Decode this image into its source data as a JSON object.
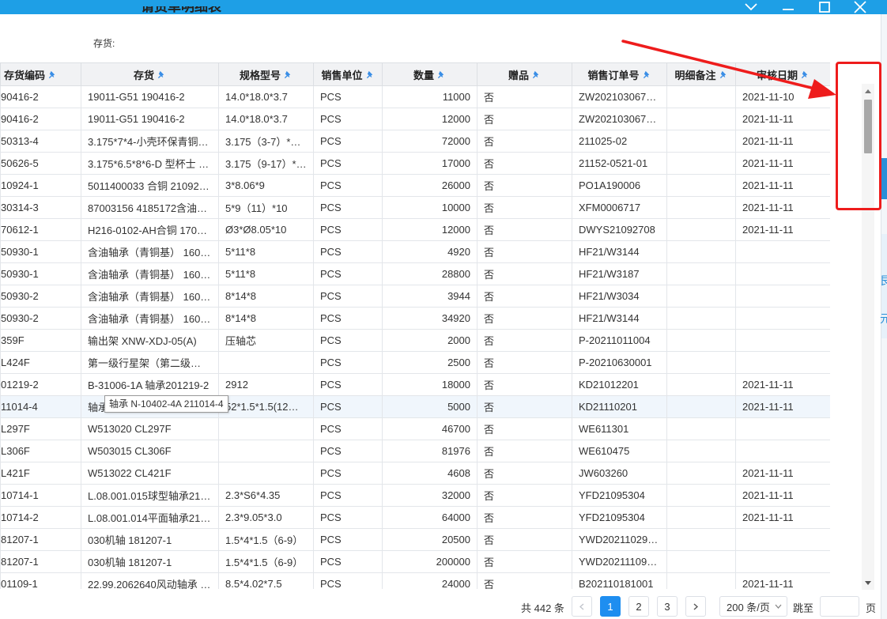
{
  "window": {
    "controls": [
      "chevron-down-icon",
      "minimize-icon",
      "maximize-icon",
      "close-icon"
    ],
    "accent": "#1e9fe6"
  },
  "header": {
    "title": "请货单明细表",
    "filter_label": "存货:"
  },
  "table": {
    "columns": [
      "存货编码",
      "存货",
      "规格型号",
      "销售单位",
      "数量",
      "赠品",
      "销售订单号",
      "明细备注",
      "审核日期"
    ],
    "rows": [
      [
        "90416-2",
        "19011-G51 190416-2",
        "14.0*18.0*3.7",
        "PCS",
        "11000",
        "否",
        "ZW202103067…",
        "",
        "2021-11-10"
      ],
      [
        "90416-2",
        "19011-G51 190416-2",
        "14.0*18.0*3.7",
        "PCS",
        "12000",
        "否",
        "ZW202103067…",
        "",
        "2021-11-11"
      ],
      [
        "50313-4",
        "3.175*7*4-小壳环保青铜…",
        "3.175（3-7）*…",
        "PCS",
        "72000",
        "否",
        "211025-02",
        "",
        "2021-11-11"
      ],
      [
        "50626-5",
        "3.175*6.5*8*6-D 型杯士 …",
        "3.175（9-17）*…",
        "PCS",
        "17000",
        "否",
        "21152-0521-01",
        "",
        "2021-11-11"
      ],
      [
        "10924-1",
        "5011400033 合铜 21092…",
        "3*8.06*9",
        "PCS",
        "26000",
        "否",
        "PO1A190006",
        "",
        "2021-11-11"
      ],
      [
        "30314-3",
        "87003156 4185172含油…",
        "5*9（11）*10",
        "PCS",
        "10000",
        "否",
        "XFM0006717",
        "",
        "2021-11-11"
      ],
      [
        "70612-1",
        "H216-0102-AH合铜 1706…",
        "Ø3*Ø8.05*10",
        "PCS",
        "12000",
        "否",
        "DWYS21092708",
        "",
        "2021-11-11"
      ],
      [
        "50930-1",
        "含油轴承（青铜基） 160…",
        "5*11*8",
        "PCS",
        "4920",
        "否",
        "HF21/W3144",
        "",
        ""
      ],
      [
        "50930-1",
        "含油轴承（青铜基） 160…",
        "5*11*8",
        "PCS",
        "28800",
        "否",
        "HF21/W3187",
        "",
        ""
      ],
      [
        "50930-2",
        "含油轴承（青铜基） 160…",
        "8*14*8",
        "PCS",
        "3944",
        "否",
        "HF21/W3034",
        "",
        ""
      ],
      [
        "50930-2",
        "含油轴承（青铜基） 160…",
        "8*14*8",
        "PCS",
        "34920",
        "否",
        "HF21/W3144",
        "",
        ""
      ],
      [
        "359F",
        "输出架 XNW-XDJ-05(A)",
        "压轴芯",
        "PCS",
        "2000",
        "否",
        "P-20211011004",
        "",
        ""
      ],
      [
        "L424F",
        "第一级行星架（第二级…",
        "",
        "PCS",
        "2500",
        "否",
        "P-20210630001",
        "",
        ""
      ],
      [
        "01219-2",
        "B-31006-1A 轴承201219-2",
        "2912",
        "PCS",
        "18000",
        "否",
        "KD21012201",
        "",
        "2021-11-11"
      ],
      [
        "11014-4",
        "轴承",
        "52*1.5*1.5(12…",
        "PCS",
        "5000",
        "否",
        "KD21110201",
        "",
        "2021-11-11"
      ],
      [
        "L297F",
        "W513020 CL297F",
        "",
        "PCS",
        "46700",
        "否",
        "WE611301",
        "",
        ""
      ],
      [
        "L306F",
        "W503015 CL306F",
        "",
        "PCS",
        "81976",
        "否",
        "WE610475",
        "",
        ""
      ],
      [
        "L421F",
        "W513022 CL421F",
        "",
        "PCS",
        "4608",
        "否",
        "JW603260",
        "",
        "2021-11-11"
      ],
      [
        "10714-1",
        "L.08.001.015球型轴承21…",
        "2.3*S6*4.35",
        "PCS",
        "32000",
        "否",
        "YFD21095304",
        "",
        "2021-11-11"
      ],
      [
        "10714-2",
        "L.08.001.014平面轴承21…",
        "2.3*9.05*3.0",
        "PCS",
        "64000",
        "否",
        "YFD21095304",
        "",
        "2021-11-11"
      ],
      [
        "81207-1",
        "030机轴 181207-1",
        "1.5*4*1.5（6-9）",
        "PCS",
        "20500",
        "否",
        "YWD20211029…",
        "",
        ""
      ],
      [
        "81207-1",
        "030机轴 181207-1",
        "1.5*4*1.5（6-9）",
        "PCS",
        "200000",
        "否",
        "YWD20211109…",
        "",
        ""
      ],
      [
        "01109-1",
        "22.99.2062640风动轴承 …",
        "8.5*4.02*7.5",
        "PCS",
        "24000",
        "否",
        "B202110181001",
        "",
        "2021-11-11"
      ]
    ],
    "hover_row_index": 14
  },
  "tooltip": {
    "text": "轴承 N-10402-4A 211014-4"
  },
  "pagination": {
    "total_text": "共 442 条",
    "pages": [
      "1",
      "2",
      "3"
    ],
    "current_page": "1",
    "page_size": "200 条/页",
    "jump_label": "跳至",
    "jump_value": "",
    "page_suffix": "页"
  },
  "annotation": {
    "color": "#ee1c1c"
  },
  "edge_glyphs": [
    "艮",
    "元"
  ]
}
